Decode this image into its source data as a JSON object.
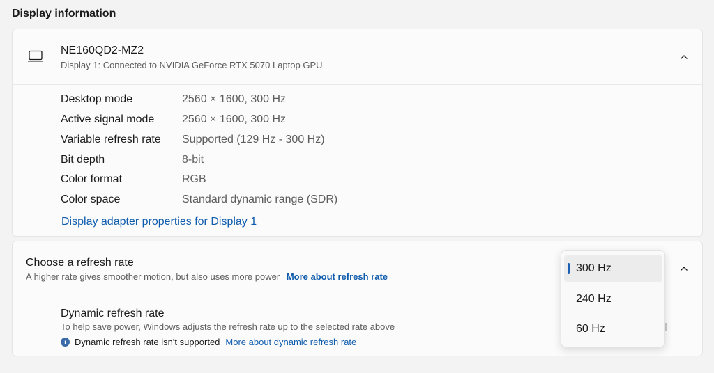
{
  "section_title": "Display information",
  "display": {
    "name": "NE160QD2-MZ2",
    "subtitle": "Display 1: Connected to NVIDIA GeForce RTX 5070 Laptop GPU",
    "icon": "laptop-icon",
    "collapse_icon": "chevron-up-icon",
    "info": [
      {
        "label": "Desktop mode",
        "value": "2560 × 1600, 300 Hz"
      },
      {
        "label": "Active signal mode",
        "value": "2560 × 1600, 300 Hz"
      },
      {
        "label": "Variable refresh rate",
        "value": "Supported (129 Hz - 300 Hz)"
      },
      {
        "label": "Bit depth",
        "value": "8-bit"
      },
      {
        "label": "Color format",
        "value": "RGB"
      },
      {
        "label": "Color space",
        "value": "Standard dynamic range (SDR)"
      }
    ],
    "adapter_link": "Display adapter properties for Display 1"
  },
  "refresh": {
    "title": "Choose a refresh rate",
    "subtitle": "A higher rate gives smoother motion, but also uses more power",
    "link": "More about refresh rate",
    "collapse_icon": "chevron-up-icon",
    "options": [
      "300 Hz",
      "240 Hz",
      "60 Hz"
    ],
    "selected": "300 Hz"
  },
  "dynamic": {
    "title": "Dynamic refresh rate",
    "subtitle": "To help save power, Windows adjusts the refresh rate up to the selected rate above",
    "info_icon_glyph": "i",
    "status": "Dynamic refresh rate isn't supported",
    "link": "More about dynamic refresh rate"
  },
  "colors": {
    "link": "#0f5cad",
    "accent": "#1a5fb4",
    "info_icon": "#3b6aa8"
  }
}
